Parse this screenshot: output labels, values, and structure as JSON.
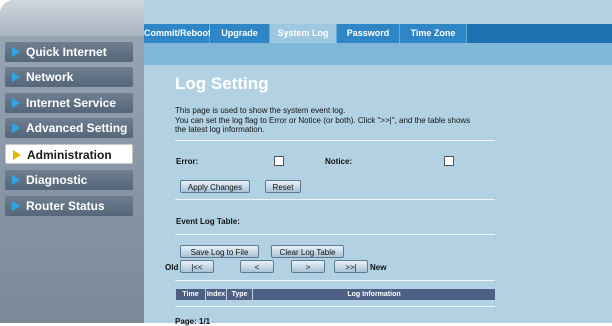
{
  "sidebar": {
    "items": [
      {
        "label": "Quick Internet Setup",
        "active": false
      },
      {
        "label": "Network",
        "active": false
      },
      {
        "label": "Internet Service",
        "active": false
      },
      {
        "label": "Advanced Setting",
        "active": false
      },
      {
        "label": "Administration",
        "active": true
      },
      {
        "label": "Diagnostic",
        "active": false
      },
      {
        "label": "Router Status",
        "active": false
      }
    ]
  },
  "tabs": [
    {
      "label": "Commit/Reboot",
      "active": false
    },
    {
      "label": "Upgrade",
      "active": false
    },
    {
      "label": "System Log",
      "active": true
    },
    {
      "label": "Password",
      "active": false
    },
    {
      "label": "Time Zone",
      "active": false
    }
  ],
  "page": {
    "title": "Log Setting",
    "description_line1": "This page is used to show the system event log.",
    "description_line2": "You can set the log flag to Error or Notice (or both). Click \">>|\", and the table shows",
    "description_line3": "the latest log information.",
    "error_label": "Error:",
    "notice_label": "Notice:",
    "apply_button": "Apply Changes",
    "reset_button": "Reset",
    "event_log_table_label": "Event Log Table:",
    "save_log_button": "Save Log to File",
    "clear_log_button": "Clear Log Table",
    "old_label": "Old",
    "first_button": "|<<",
    "prev_button": "<",
    "next_button": ">",
    "last_button": ">>|",
    "new_label": "New",
    "table_headers": [
      "Time",
      "Index",
      "Type",
      "Log Information"
    ],
    "page_indicator": "Page: 1/1"
  },
  "colors": {
    "tab_bar": "#1d72b0",
    "content_bg": "#b2d2e4",
    "table_header": "#4d5f84",
    "nav_arrow": "#2da6e8"
  }
}
